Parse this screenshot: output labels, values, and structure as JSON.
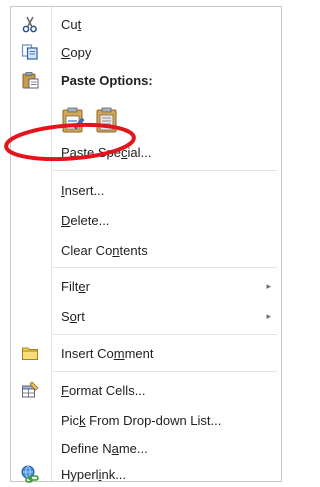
{
  "menu": {
    "items": [
      {
        "label_pre": "Cu",
        "label_u": "t",
        "label_post": "",
        "icon": "scissors-icon"
      },
      {
        "label_pre": "",
        "label_u": "C",
        "label_post": "opy",
        "icon": "copy-icon"
      },
      {
        "label_pre": "Paste Options:",
        "label_u": "",
        "label_post": "",
        "icon": "paste-clipboard-icon"
      },
      {
        "label_pre": "Paste Spe",
        "label_u": "c",
        "label_post": "ial...",
        "icon": ""
      },
      {
        "label_pre": "",
        "label_u": "I",
        "label_post": "nsert...",
        "icon": ""
      },
      {
        "label_pre": "",
        "label_u": "D",
        "label_post": "elete...",
        "icon": ""
      },
      {
        "label_pre": "Clear Co",
        "label_u": "n",
        "label_post": "tents",
        "icon": ""
      },
      {
        "label_pre": "Filt",
        "label_u": "e",
        "label_post": "r",
        "icon": "",
        "submenu": true
      },
      {
        "label_pre": "S",
        "label_u": "o",
        "label_post": "rt",
        "icon": "",
        "submenu": true
      },
      {
        "label_pre": "Insert Co",
        "label_u": "m",
        "label_post": "ment",
        "icon": "insert-comment-icon"
      },
      {
        "label_pre": "",
        "label_u": "F",
        "label_post": "ormat Cells...",
        "icon": "format-cells-icon"
      },
      {
        "label_pre": "Pic",
        "label_u": "k",
        "label_post": " From Drop-down List...",
        "icon": ""
      },
      {
        "label_pre": "Define N",
        "label_u": "a",
        "label_post": "me...",
        "icon": ""
      },
      {
        "label_pre": "Hyperl",
        "label_u": "i",
        "label_post": "nk...",
        "icon": "hyperlink-icon"
      }
    ],
    "paste_options": [
      "paste-icon",
      "paste-values-icon"
    ],
    "submenu_arrow": "▸"
  },
  "colors": {
    "highlight_ring": "#e3141b",
    "text": "#1f1f1f",
    "separator": "#e2e3e5"
  }
}
